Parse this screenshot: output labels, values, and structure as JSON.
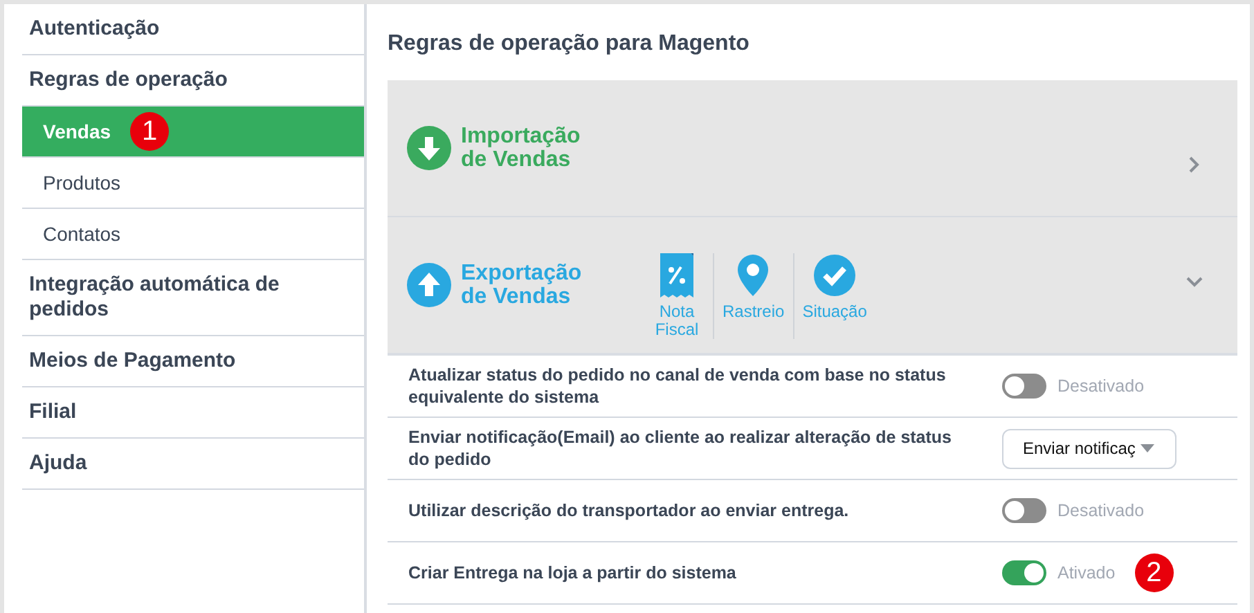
{
  "sidebar": {
    "items": [
      {
        "label": "Autenticação",
        "selected": false
      },
      {
        "label": "Regras de operação",
        "selected": false,
        "children": [
          {
            "label": "Vendas",
            "selected": true,
            "badge": "1"
          },
          {
            "label": "Produtos",
            "selected": false
          },
          {
            "label": "Contatos",
            "selected": false
          }
        ]
      },
      {
        "label": "Integração automática de pedidos",
        "selected": false
      },
      {
        "label": "Meios de Pagamento",
        "selected": false
      },
      {
        "label": "Filial",
        "selected": false
      },
      {
        "label": "Ajuda",
        "selected": false
      }
    ]
  },
  "main": {
    "title": "Regras de operação para Magento",
    "sections": [
      {
        "kind": "import",
        "title": "Importação de Vendas",
        "expanded": false
      },
      {
        "kind": "export",
        "title": "Exportação de Vendas",
        "expanded": true,
        "actions": [
          {
            "kind": "receipt",
            "label": "Nota Fiscal"
          },
          {
            "kind": "pin",
            "label": "Rastreio"
          },
          {
            "kind": "check",
            "label": "Situação"
          }
        ]
      }
    ],
    "settings": [
      {
        "kind": "toggle",
        "label": "Atualizar status do pedido no canal de venda com base no status equivalente do sistema",
        "on": false,
        "status": "Desativado"
      },
      {
        "kind": "select",
        "label": "Enviar notificação(Email) ao cliente ao realizar alteração de status do pedido",
        "value": "Enviar notificaç"
      },
      {
        "kind": "toggle",
        "label": "Utilizar descrição do transportador ao enviar entrega.",
        "on": false,
        "status": "Desativado"
      },
      {
        "kind": "toggle",
        "label": "Criar Entrega na loja a partir do sistema",
        "on": true,
        "status": "Ativado",
        "badge": "2"
      }
    ]
  }
}
